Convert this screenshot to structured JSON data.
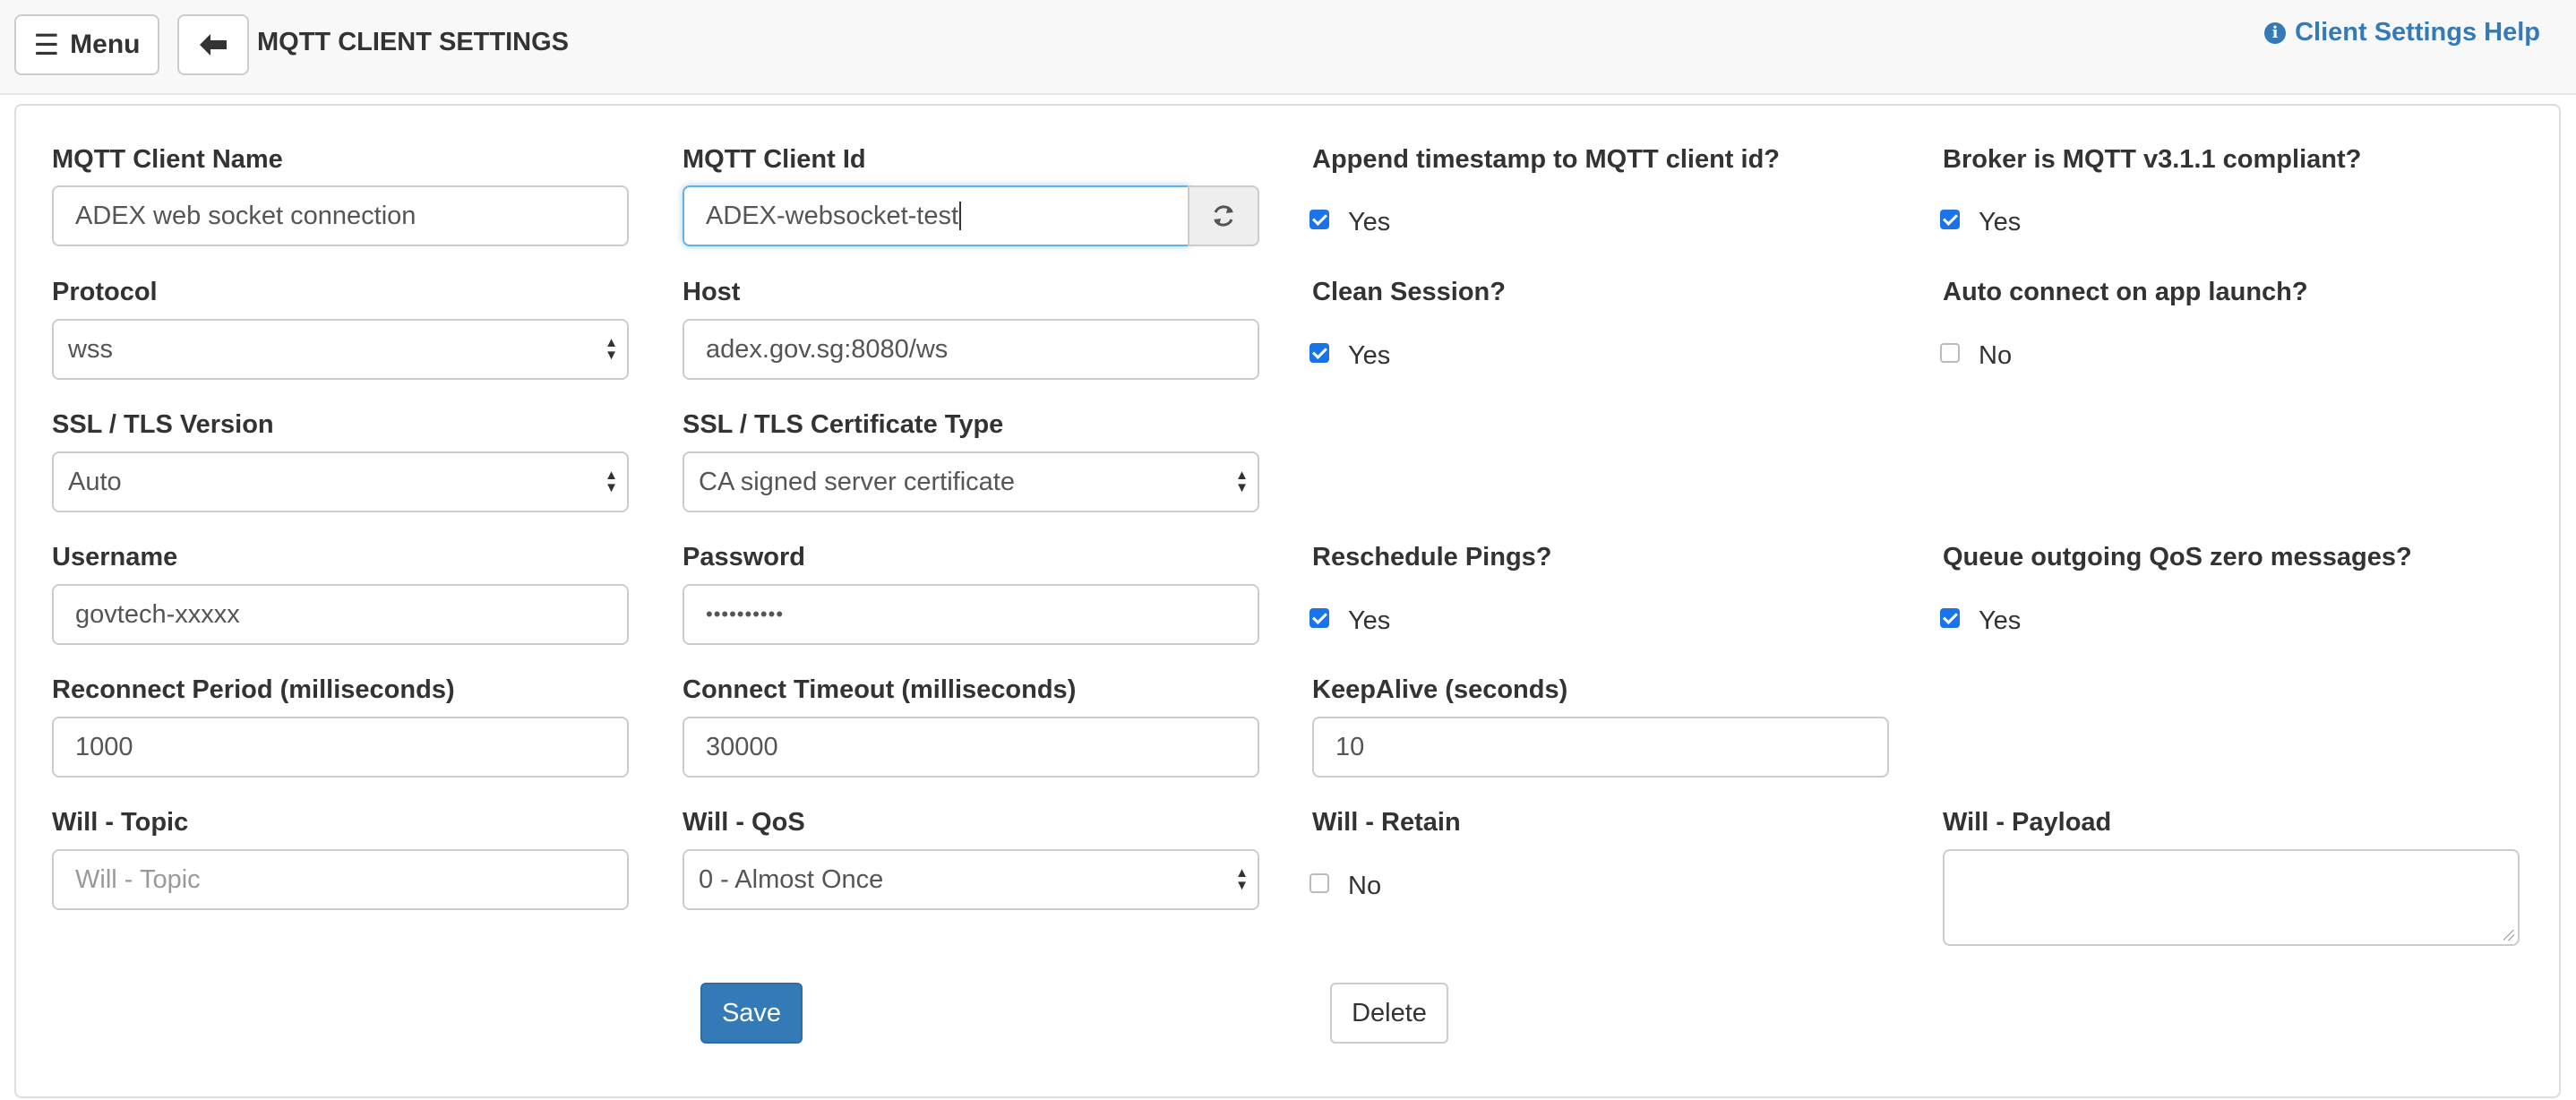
{
  "header": {
    "menu_label": "Menu",
    "menu_icon": "hamburger-icon",
    "back_icon": "arrow-left-icon",
    "title": "MQTT CLIENT SETTINGS",
    "help_icon": "info-circle-icon",
    "help_label": "Client Settings Help"
  },
  "form": {
    "client_name": {
      "label": "MQTT Client Name",
      "value": "ADEX web socket connection"
    },
    "client_id": {
      "label": "MQTT Client Id",
      "value": "ADEX-websocket-test",
      "refresh_icon": "refresh-icon"
    },
    "append_timestamp": {
      "label": "Append timestamp to MQTT client id?",
      "checked": true,
      "option": "Yes"
    },
    "broker_compliant": {
      "label": "Broker is MQTT v3.1.1 compliant?",
      "checked": true,
      "option": "Yes"
    },
    "protocol": {
      "label": "Protocol",
      "value": "wss"
    },
    "host": {
      "label": "Host",
      "value": "adex.gov.sg:8080/ws"
    },
    "clean_session": {
      "label": "Clean Session?",
      "checked": true,
      "option": "Yes"
    },
    "auto_connect": {
      "label": "Auto connect on app launch?",
      "checked": false,
      "option": "No"
    },
    "ssl_version": {
      "label": "SSL / TLS Version",
      "value": "Auto"
    },
    "cert_type": {
      "label": "SSL / TLS Certificate Type",
      "value": "CA signed server certificate"
    },
    "username": {
      "label": "Username",
      "value": "govtech-xxxxx"
    },
    "password": {
      "label": "Password",
      "value": "••••••••••"
    },
    "reschedule_pings": {
      "label": "Reschedule Pings?",
      "checked": true,
      "option": "Yes"
    },
    "queue_qos_zero": {
      "label": "Queue outgoing QoS zero messages?",
      "checked": true,
      "option": "Yes"
    },
    "reconnect_period": {
      "label": "Reconnect Period (milliseconds)",
      "value": "1000"
    },
    "connect_timeout": {
      "label": "Connect Timeout (milliseconds)",
      "value": "30000"
    },
    "keepalive": {
      "label": "KeepAlive (seconds)",
      "value": "10"
    },
    "will_topic": {
      "label": "Will - Topic",
      "value": "",
      "placeholder": "Will - Topic"
    },
    "will_qos": {
      "label": "Will - QoS",
      "value": "0 - Almost Once"
    },
    "will_retain": {
      "label": "Will - Retain",
      "checked": false,
      "option": "No"
    },
    "will_payload": {
      "label": "Will - Payload",
      "value": ""
    }
  },
  "actions": {
    "save_label": "Save",
    "delete_label": "Delete"
  },
  "colors": {
    "primary": "#337ab7",
    "checkbox": "#1a73e8",
    "focus": "#66afe9"
  }
}
